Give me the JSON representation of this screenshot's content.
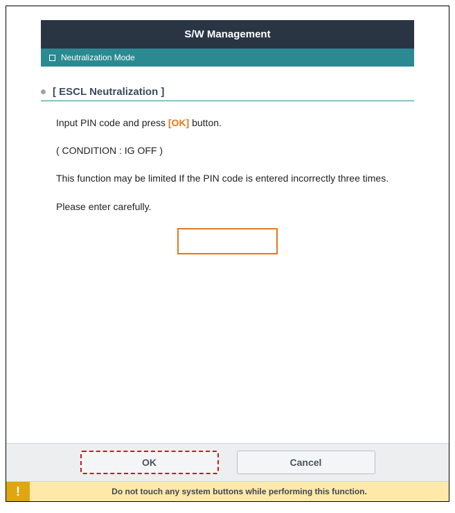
{
  "header": {
    "title": "S/W Management"
  },
  "modeBar": {
    "label": "Neutralization Mode"
  },
  "section": {
    "title": "[ ESCL Neutralization ]",
    "instruction_prefix": "Input PIN code and press ",
    "instruction_ok": "[OK]",
    "instruction_suffix": " button.",
    "condition": "( CONDITION : IG OFF )",
    "caution": "This function may be limited If the PIN code is entered incorrectly three times.",
    "careful": "Please enter carefully."
  },
  "input": {
    "pin_value": ""
  },
  "buttons": {
    "ok": "OK",
    "cancel": "Cancel"
  },
  "warning": {
    "icon": "!",
    "text": "Do not touch any system buttons while performing this function."
  }
}
